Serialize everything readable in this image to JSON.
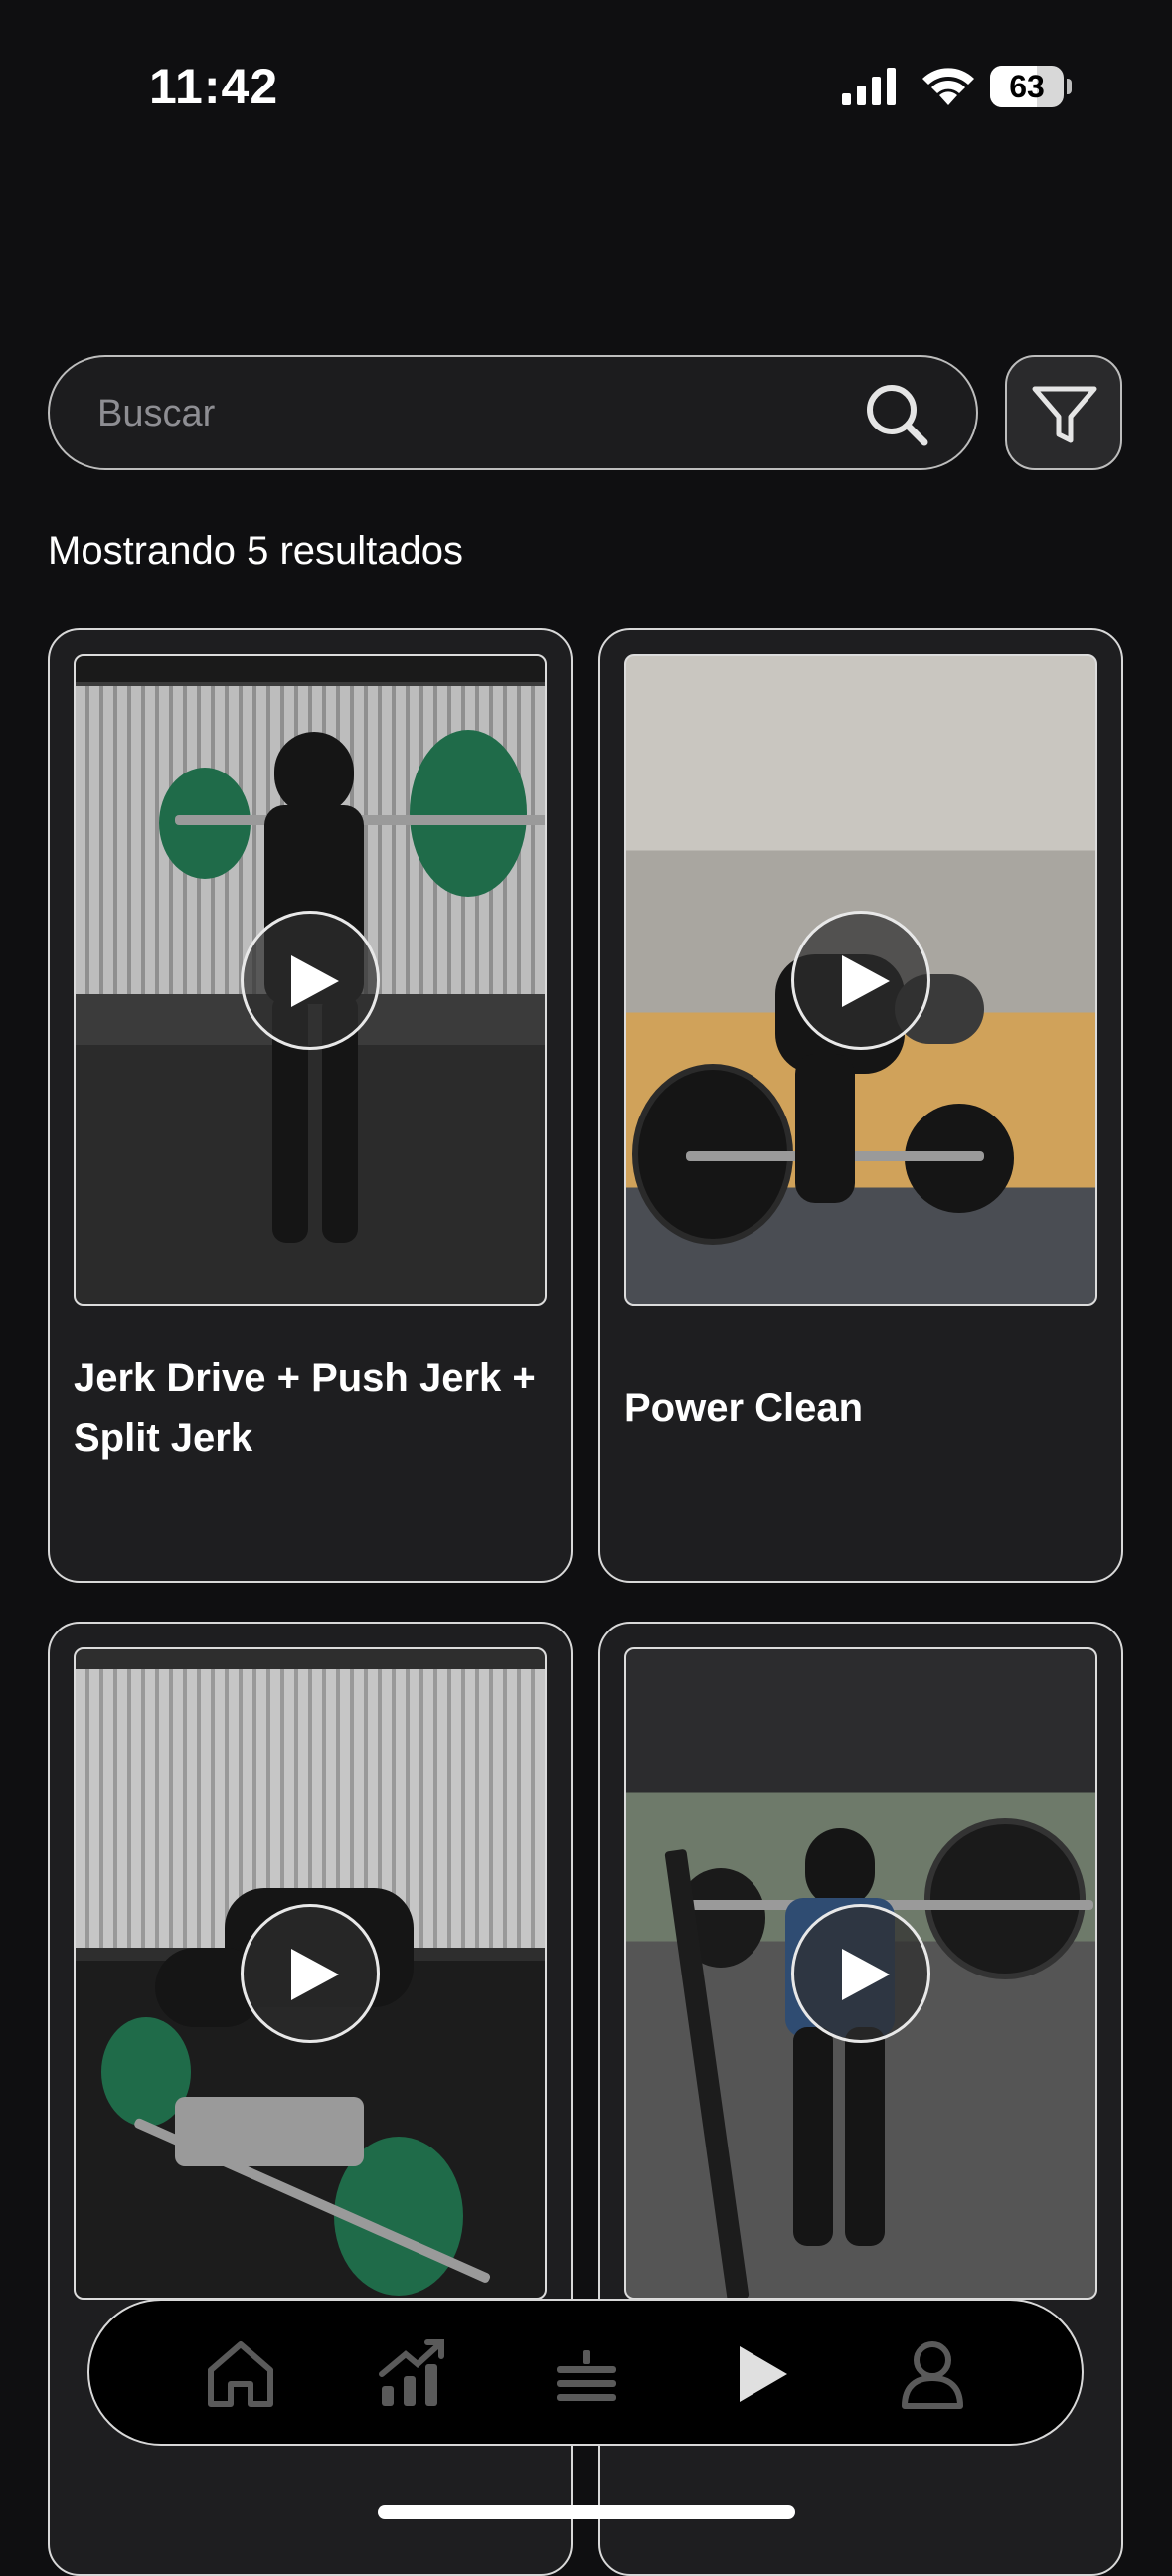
{
  "status": {
    "time": "11:42",
    "battery": "63",
    "battery_level": 0.63
  },
  "search": {
    "placeholder": "Buscar"
  },
  "results_text": "Mostrando 5 resultados",
  "cards": [
    {
      "title": "Jerk Drive + Push Jerk + Split Jerk"
    },
    {
      "title": "Power Clean"
    },
    {
      "title": ""
    },
    {
      "title": ""
    }
  ],
  "tabbar": {
    "items": [
      "home-icon",
      "progress-chart-icon",
      "list-icon",
      "play-icon",
      "profile-icon"
    ],
    "active": "play-icon"
  },
  "colors": {
    "background": "#0f0f11",
    "card": "#1e1e20",
    "border": "#d8d8d8",
    "muted": "#8e8e93"
  }
}
